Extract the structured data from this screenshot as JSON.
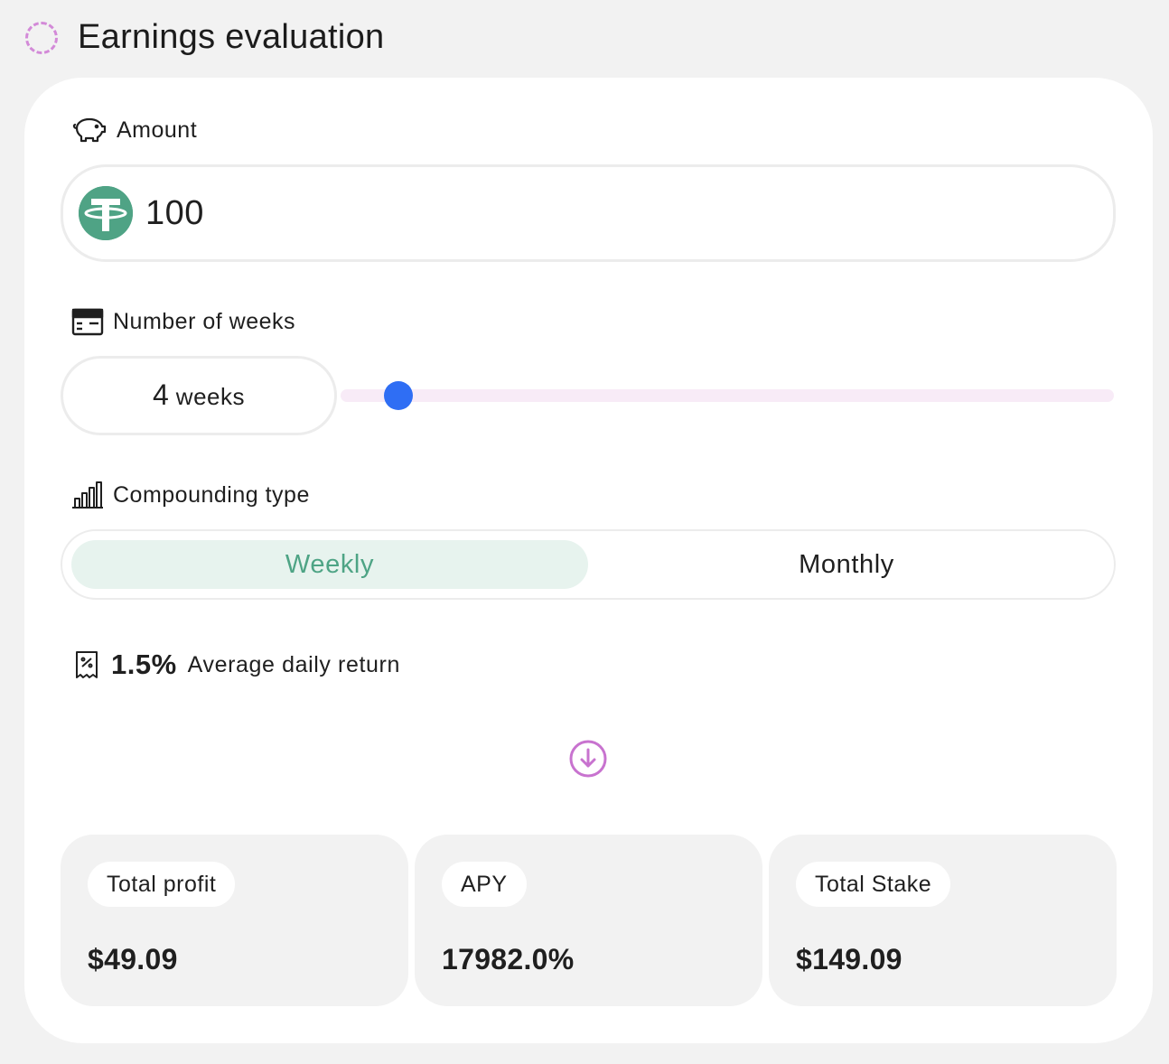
{
  "header": {
    "title": "Earnings evaluation",
    "icon": "loading-spinner-icon"
  },
  "amount": {
    "label": "Amount",
    "icon": "piggy-bank-icon",
    "token_icon": "tether-icon",
    "value": "100"
  },
  "weeks": {
    "label": "Number of weeks",
    "icon": "calendar-icon",
    "value": "4",
    "unit": "weeks",
    "slider_fraction": 0.075
  },
  "compounding": {
    "label": "Compounding type",
    "icon": "bar-chart-icon",
    "options": [
      "Weekly",
      "Monthly"
    ],
    "selected": "Weekly"
  },
  "daily_return": {
    "icon": "receipt-percent-icon",
    "value": "1.5%",
    "label": "Average daily return"
  },
  "divider_icon": "arrow-down-circle-icon",
  "results": [
    {
      "label": "Total profit",
      "value": "$49.09"
    },
    {
      "label": "APY",
      "value": "17982.0%"
    },
    {
      "label": "Total Stake",
      "value": "$149.09"
    }
  ],
  "colors": {
    "accent_green": "#4ea485",
    "accent_green_bg": "#e7f3ee",
    "accent_pink": "#d38ad8",
    "slider_thumb": "#2f6ef4",
    "slider_track": "#f8ebf7"
  }
}
